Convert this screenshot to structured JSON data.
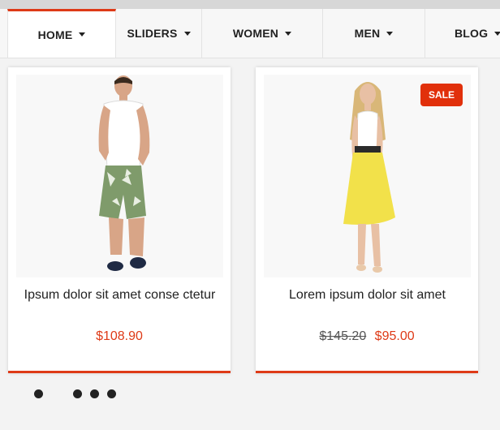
{
  "nav": {
    "items": [
      {
        "label": "HOME",
        "active": true
      },
      {
        "label": "SLIDERS",
        "active": false
      },
      {
        "label": "WOMEN",
        "active": false
      },
      {
        "label": "MEN",
        "active": false
      },
      {
        "label": "BLOG",
        "active": false
      }
    ]
  },
  "products": [
    {
      "title": "Ipsum dolor sit amet conse ctetur",
      "price": "$108.90",
      "old_price": "",
      "badge": ""
    },
    {
      "title": "Lorem ipsum dolor sit amet",
      "price": "$95.00",
      "old_price": "$145.20",
      "badge": "SALE"
    }
  ],
  "carousel": {
    "dots": 4
  },
  "colors": {
    "accent": "#de3a17",
    "sale_badge": "#e1300b",
    "text": "#222222"
  }
}
